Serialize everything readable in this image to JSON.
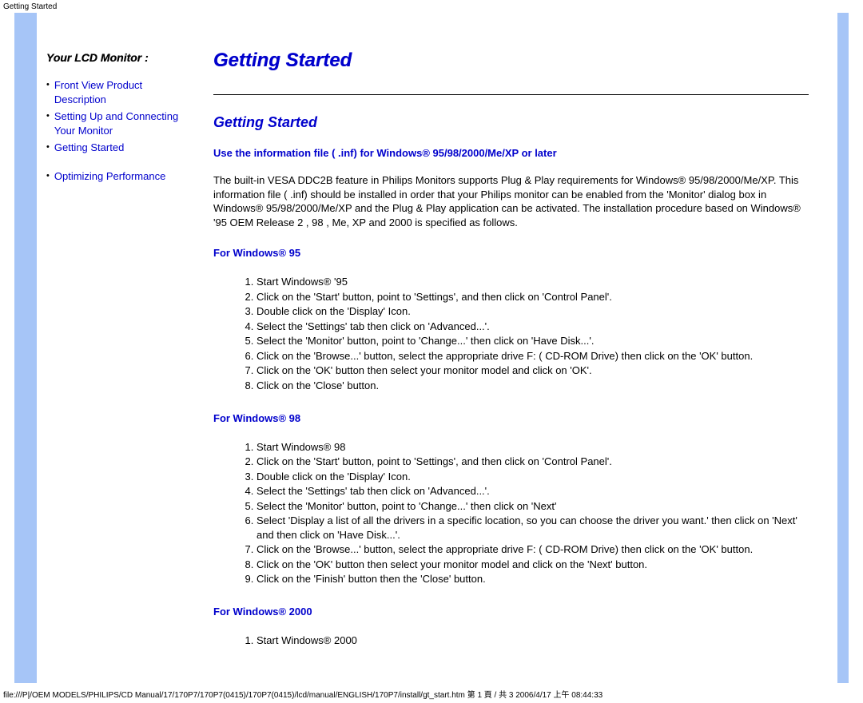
{
  "top_label": "Getting Started",
  "sidebar": {
    "title": "Your LCD Monitor :",
    "items": [
      {
        "label": "Front View Product Description"
      },
      {
        "label": "Setting Up and Connecting Your Monitor"
      },
      {
        "label": "Getting Started"
      },
      {
        "label": "Optimizing Performance"
      }
    ]
  },
  "content": {
    "page_title": "Getting Started",
    "section_title": "Getting Started",
    "subsection": "Use the information file ( .inf) for Windows® 95/98/2000/Me/XP or later",
    "body_text": "The built-in VESA DDC2B feature in Philips Monitors supports Plug & Play requirements for Windows® 95/98/2000/Me/XP. This information file ( .inf) should be installed in order that your Philips monitor can be enabled from the 'Monitor' dialog box in Windows® 95/98/2000/Me/XP and the Plug & Play application can be activated. The installation procedure based on Windows® '95 OEM Release 2 , 98 , Me, XP and 2000 is specified as follows.",
    "sections": [
      {
        "heading": "For Windows® 95",
        "steps": [
          "Start Windows® '95",
          "Click on the 'Start' button, point to 'Settings', and then click on 'Control Panel'.",
          "Double click on the 'Display' Icon.",
          "Select the 'Settings' tab then click on 'Advanced...'.",
          "Select the 'Monitor' button, point to 'Change...' then click on 'Have Disk...'.",
          "Click on the 'Browse...' button, select the appropriate drive F: ( CD-ROM Drive) then click on the 'OK' button.",
          "Click on the 'OK' button then select your monitor model and click on 'OK'.",
          "Click on the 'Close' button."
        ]
      },
      {
        "heading": "For Windows® 98",
        "steps": [
          "Start Windows® 98",
          "Click on the 'Start' button, point to 'Settings', and then click on 'Control Panel'.",
          "Double click on the 'Display' Icon.",
          "Select the 'Settings' tab then click on 'Advanced...'.",
          "Select the 'Monitor' button, point to 'Change...' then click on 'Next'",
          "Select 'Display a list of all the drivers in a specific location, so you can choose the driver you want.' then click on 'Next' and then click on 'Have Disk...'.",
          "Click on the 'Browse...' button, select the appropriate drive F: ( CD-ROM Drive) then click on the 'OK' button.",
          "Click on the 'OK' button then select your monitor model and click on the 'Next' button.",
          "Click on the 'Finish' button then the 'Close' button."
        ]
      },
      {
        "heading": "For Windows® 2000",
        "steps": [
          "Start Windows® 2000"
        ]
      }
    ]
  },
  "footer": "file:///P|/OEM MODELS/PHILIPS/CD Manual/17/170P7/170P7(0415)/170P7(0415)/lcd/manual/ENGLISH/170P7/install/gt_start.htm 第 1 頁 / 共 3 2006/4/17 上午 08:44:33"
}
